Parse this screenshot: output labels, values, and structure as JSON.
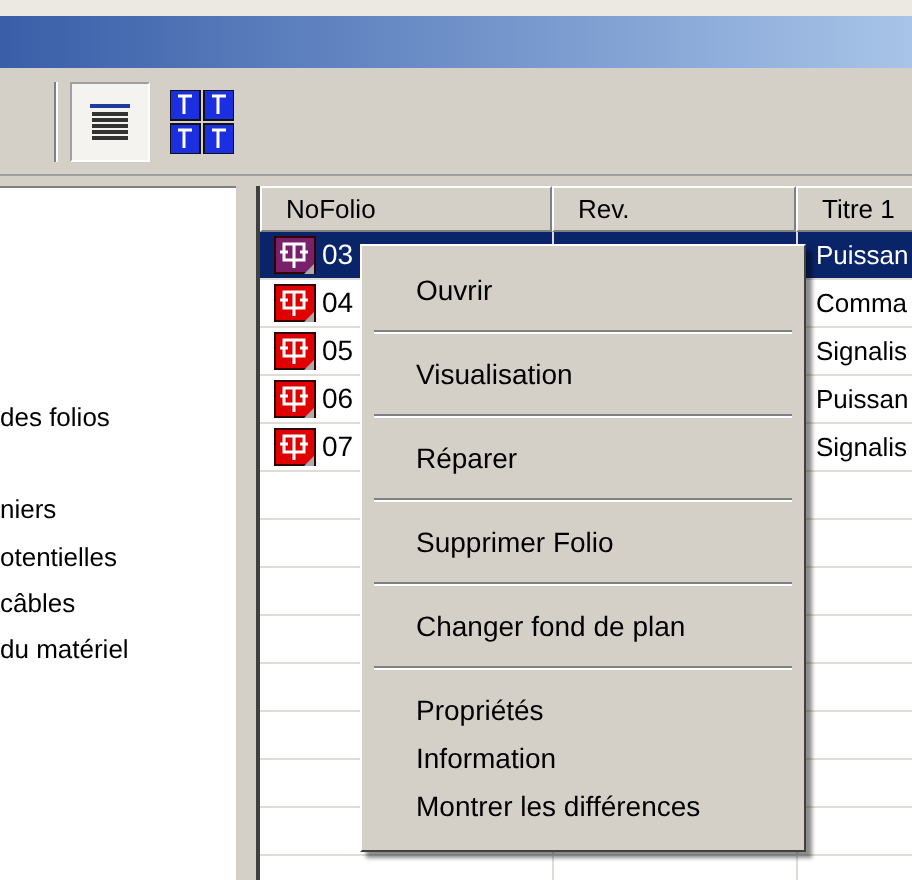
{
  "window": {
    "title_bar": {
      "active": true
    }
  },
  "toolbar": {
    "buttons": [
      {
        "kind": "list",
        "pressed": true
      },
      {
        "kind": "grid",
        "pressed": false
      }
    ]
  },
  "tree": {
    "items": [
      "des folios",
      "niers",
      "otentielles",
      "câbles",
      "du matériel"
    ]
  },
  "table": {
    "columns": [
      "NoFolio",
      "Rev.",
      "Titre 1"
    ],
    "rows": [
      {
        "nofolio": "03",
        "titre": "Puissan",
        "selected": true
      },
      {
        "nofolio": "04",
        "titre": "Comma",
        "selected": false
      },
      {
        "nofolio": "05",
        "titre": "Signalis",
        "selected": false
      },
      {
        "nofolio": "06",
        "titre": "Puissan",
        "selected": false
      },
      {
        "nofolio": "07",
        "titre": "Signalis",
        "selected": false
      }
    ]
  },
  "context_menu": {
    "groups": [
      [
        "Ouvrir"
      ],
      [
        "Visualisation"
      ],
      [
        "Réparer"
      ],
      [
        "Supprimer Folio"
      ],
      [
        "Changer fond de plan"
      ],
      [
        "Propriétés",
        "Information",
        "Montrer les différences"
      ]
    ]
  }
}
